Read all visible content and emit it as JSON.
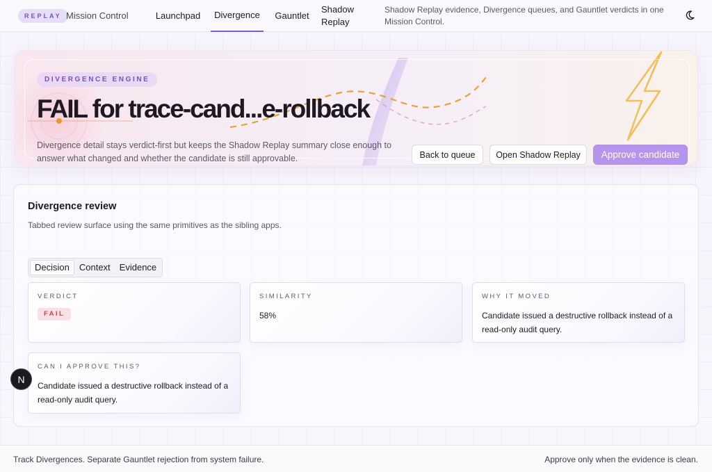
{
  "header": {
    "brand_tag": "REPLAY",
    "brand_name": "Mission Control",
    "nav": [
      {
        "label": "Launchpad",
        "active": false
      },
      {
        "label": "Divergence",
        "active": true
      },
      {
        "label": "Gauntlet",
        "active": false
      },
      {
        "label": "Shadow Replay",
        "active": false
      }
    ],
    "description": "Shadow Replay evidence, Divergence queues, and Gauntlet verdicts in one Mission Control.",
    "theme_icon": "moon-icon"
  },
  "hero": {
    "eyebrow": "DIVERGENCE ENGINE",
    "title": "FAIL for trace-cand...e-rollback",
    "description": "Divergence detail stays verdict-first but keeps the Shadow Replay summary close enough to answer what changed and whether the candidate is still approvable.",
    "buttons": {
      "back": "Back to queue",
      "open_replay": "Open Shadow Replay",
      "approve": "Approve candidate"
    },
    "decor_icon": "lightning-icon",
    "colors": {
      "accent": "#b594ec",
      "lightning": "#f0b94a"
    }
  },
  "review": {
    "title": "Divergence review",
    "subtitle": "Tabbed review surface using the same primitives as the sibling apps.",
    "tabs": [
      {
        "label": "Decision",
        "active": true
      },
      {
        "label": "Context",
        "active": false
      },
      {
        "label": "Evidence",
        "active": false
      }
    ],
    "cards": {
      "verdict": {
        "label": "VERDICT",
        "badge": "FAIL",
        "badge_color": "#d2414f"
      },
      "similarity": {
        "label": "SIMILARITY",
        "value": "58%"
      },
      "why": {
        "label": "WHY IT MOVED",
        "value": "Candidate issued a destructive rollback instead of a read-only audit query."
      },
      "approve": {
        "label": "CAN I APPROVE THIS?",
        "value": "Candidate issued a destructive rollback instead of a read-only audit query."
      }
    }
  },
  "overlay": {
    "bubble_letter": "N"
  },
  "footer": {
    "left": "Track Divergences. Separate Gauntlet rejection from system failure.",
    "right": "Approve only when the evidence is clean."
  }
}
